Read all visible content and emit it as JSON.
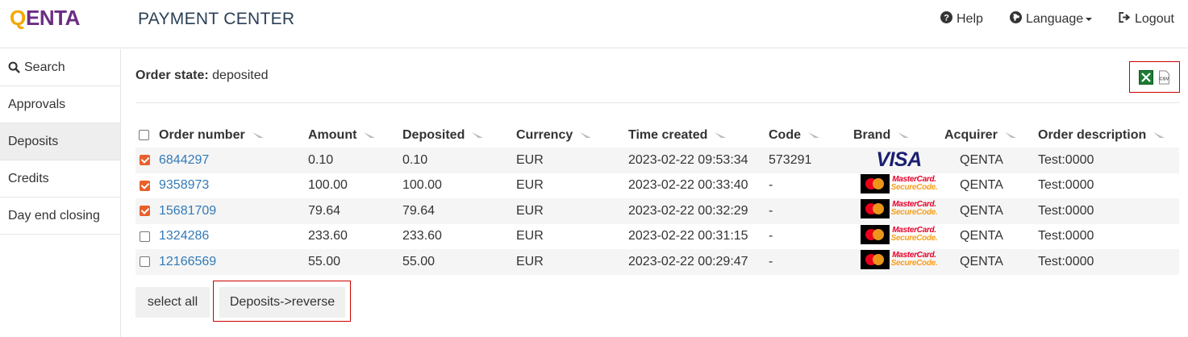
{
  "header": {
    "logo": "QENTA",
    "title": "PAYMENT CENTER",
    "help_label": "Help",
    "language_label": "Language",
    "logout_label": "Logout"
  },
  "sidebar": {
    "items": [
      {
        "label": "Search",
        "icon": "search-icon"
      },
      {
        "label": "Approvals"
      },
      {
        "label": "Deposits",
        "active": true
      },
      {
        "label": "Credits"
      },
      {
        "label": "Day end closing"
      }
    ]
  },
  "main": {
    "order_state_label": "Order state:",
    "order_state_value": "deposited",
    "export_icons": [
      "excel-icon",
      "csv-icon"
    ]
  },
  "table": {
    "columns": [
      "Order number",
      "Amount",
      "Deposited",
      "Currency",
      "Time created",
      "Code",
      "Brand",
      "Acquirer",
      "Order description"
    ],
    "rows": [
      {
        "checked": true,
        "order": "6844297",
        "amount": "0.10",
        "deposited": "0.10",
        "currency": "EUR",
        "time": "2023-02-22 09:53:34",
        "code": "573291",
        "brand": "VISA",
        "acquirer": "QENTA",
        "description": "Test:0000"
      },
      {
        "checked": true,
        "order": "9358973",
        "amount": "100.00",
        "deposited": "100.00",
        "currency": "EUR",
        "time": "2023-02-22 00:33:40",
        "code": "-",
        "brand": "MasterCard SecureCode",
        "acquirer": "QENTA",
        "description": "Test:0000"
      },
      {
        "checked": true,
        "order": "15681709",
        "amount": "79.64",
        "deposited": "79.64",
        "currency": "EUR",
        "time": "2023-02-22 00:32:29",
        "code": "-",
        "brand": "MasterCard SecureCode",
        "acquirer": "QENTA",
        "description": "Test:0000"
      },
      {
        "checked": false,
        "order": "1324286",
        "amount": "233.60",
        "deposited": "233.60",
        "currency": "EUR",
        "time": "2023-02-22 00:31:15",
        "code": "-",
        "brand": "MasterCard SecureCode",
        "acquirer": "QENTA",
        "description": "Test:0000"
      },
      {
        "checked": false,
        "order": "12166569",
        "amount": "55.00",
        "deposited": "55.00",
        "currency": "EUR",
        "time": "2023-02-22 00:29:47",
        "code": "-",
        "brand": "MasterCard SecureCode",
        "acquirer": "QENTA",
        "description": "Test:0000"
      }
    ]
  },
  "actions": {
    "select_all_label": "select all",
    "reverse_label": "Deposits->reverse"
  },
  "brand_text": {
    "visa": "VISA",
    "mc_line1": "MasterCard.",
    "mc_line2": "SecureCode."
  },
  "colors": {
    "accent_checkbox": "#e8602c",
    "link": "#337ab7",
    "highlight_outline": "#cc0000"
  }
}
